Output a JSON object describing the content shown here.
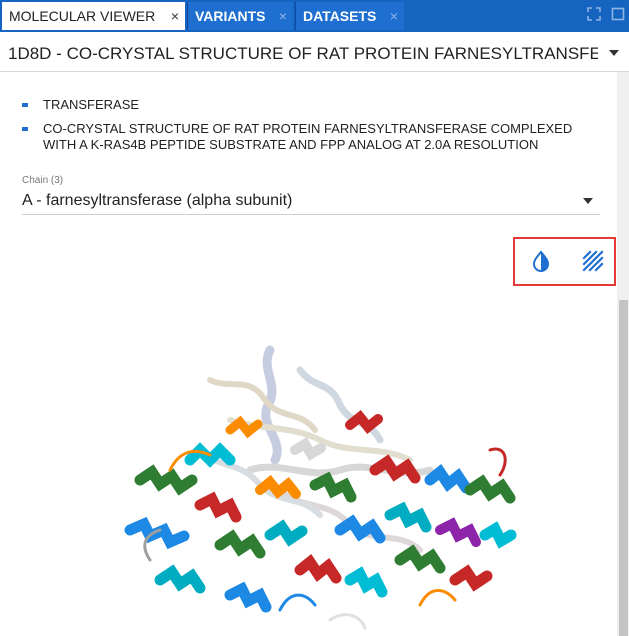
{
  "tabs": [
    {
      "label": "MOLECULAR VIEWER",
      "active": true
    },
    {
      "label": "VARIANTS",
      "active": false
    },
    {
      "label": "DATASETS",
      "active": false
    }
  ],
  "tab_close_glyph": "×",
  "window_icons": [
    "expand-icon",
    "restore-icon"
  ],
  "structure": {
    "title": "1D8D  - CO-CRYSTAL STRUCTURE OF RAT PROTEIN FARNESYLTRANSFER..."
  },
  "keywords": [
    "TRANSFERASE",
    "CO-CRYSTAL STRUCTURE OF RAT PROTEIN FARNESYLTRANSFERASE COMPLEXED WITH A K-RAS4B PEPTIDE SUBSTRATE AND FPP ANALOG AT 2.0A RESOLUTION"
  ],
  "chain": {
    "label": "Chain (3)",
    "selected": "A - farnesyltransferase (alpha subunit)"
  },
  "toolbar": {
    "buttons": [
      "color-scheme-icon",
      "representation-style-icon"
    ]
  },
  "colors": {
    "tabbar": "#1565c0",
    "accent": "#1e6fd0",
    "highlight_border": "#e53935"
  }
}
